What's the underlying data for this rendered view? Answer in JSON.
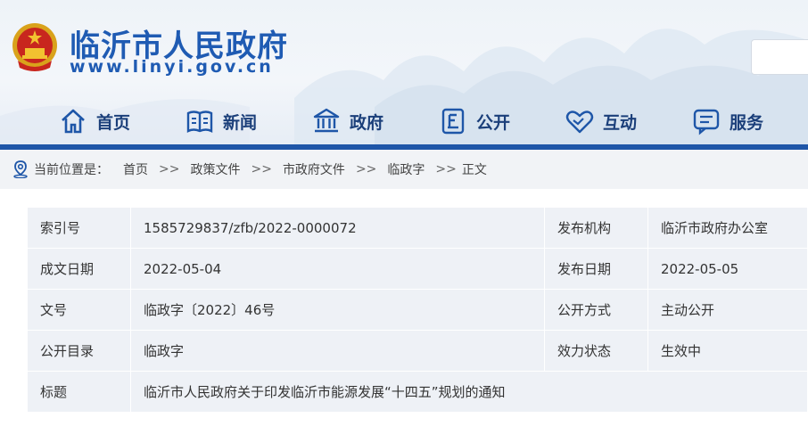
{
  "site": {
    "title": "临沂市人民政府",
    "url": "www.linyi.gov.cn",
    "emblem_icon": "national-emblem-icon",
    "accent_color": "#1e56a8"
  },
  "nav": [
    {
      "label": "首页",
      "icon": "home-icon"
    },
    {
      "label": "新闻",
      "icon": "newspaper-icon"
    },
    {
      "label": "政府",
      "icon": "government-building-icon"
    },
    {
      "label": "公开",
      "icon": "public-document-icon"
    },
    {
      "label": "互动",
      "icon": "handshake-heart-icon"
    },
    {
      "label": "服务",
      "icon": "service-chat-icon"
    }
  ],
  "breadcrumb": {
    "label": "当前位置是：",
    "items": [
      "首页",
      "政策文件",
      "市政府文件",
      "临政字",
      "正文"
    ],
    "separator": ">>"
  },
  "meta": {
    "rows": [
      {
        "k1": "索引号",
        "v1": "1585729837/zfb/2022-0000072",
        "k2": "发布机构",
        "v2": "临沂市政府办公室"
      },
      {
        "k1": "成文日期",
        "v1": "2022-05-04",
        "k2": "发布日期",
        "v2": "2022-05-05"
      },
      {
        "k1": "文号",
        "v1": "临政字〔2022〕46号",
        "k2": "公开方式",
        "v2": "主动公开"
      },
      {
        "k1": "公开目录",
        "v1": "临政字",
        "k2": "效力状态",
        "v2": "生效中"
      }
    ],
    "title_row": {
      "k": "标题",
      "v": "临沂市人民政府关于印发临沂市能源发展“十四五”规划的通知"
    }
  }
}
